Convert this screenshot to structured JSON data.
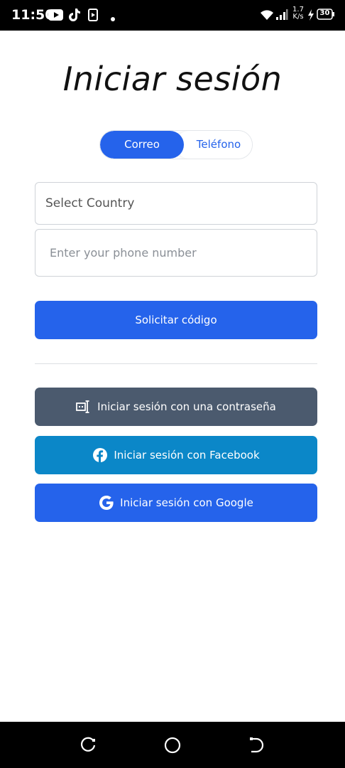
{
  "status_bar": {
    "time": "11:50",
    "network_speed_top": "1.7",
    "network_speed_bottom": "K/s",
    "battery": "30"
  },
  "page": {
    "title": "Iniciar sesión"
  },
  "toggle": {
    "email_label": "Correo",
    "phone_label": "Teléfono",
    "selected": "Correo"
  },
  "form": {
    "country_select": "Select Country",
    "phone_placeholder": "Enter your phone number",
    "request_code_label": "Solicitar código"
  },
  "alt_logins": {
    "password_label": "Iniciar sesión con una contraseña",
    "facebook_label": "Iniciar sesión con Facebook",
    "google_label": "Iniciar sesión con Google"
  },
  "colors": {
    "primary": "#2563eb",
    "password_button": "#4b5a6e",
    "facebook_button": "#0b87c8"
  },
  "icons": {
    "status_left": [
      "youtube-icon",
      "tiktok-icon",
      "media-icon",
      "dot-icon"
    ],
    "status_right": [
      "wifi-icon",
      "signal-icon",
      "charging-icon",
      "battery-icon"
    ],
    "buttons": [
      "password-icon",
      "facebook-icon",
      "google-icon"
    ],
    "nav": [
      "recents-icon",
      "home-icon",
      "back-icon"
    ]
  }
}
